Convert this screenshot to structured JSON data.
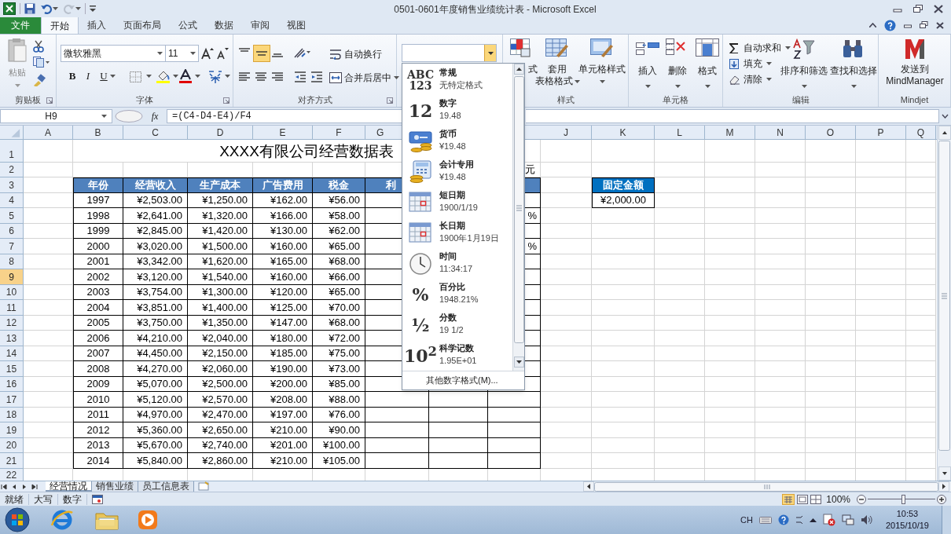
{
  "window": {
    "title": "0501-0601年度销售业绩统计表 - Microsoft Excel"
  },
  "tabs": [
    {
      "label": "文件",
      "kind": "file",
      "selected": false
    },
    {
      "label": "开始",
      "kind": "tab",
      "selected": true
    },
    {
      "label": "插入",
      "kind": "tab",
      "selected": false
    },
    {
      "label": "页面布局",
      "kind": "tab",
      "selected": false
    },
    {
      "label": "公式",
      "kind": "tab",
      "selected": false
    },
    {
      "label": "数据",
      "kind": "tab",
      "selected": false
    },
    {
      "label": "审阅",
      "kind": "tab",
      "selected": false
    },
    {
      "label": "视图",
      "kind": "tab",
      "selected": false
    }
  ],
  "ribbon": {
    "clipboard": {
      "label": "剪贴板",
      "paste": "粘贴"
    },
    "font": {
      "label": "字体",
      "font_name": "微软雅黑",
      "font_size": "11",
      "format_buttons": [
        "B",
        "I",
        "U"
      ]
    },
    "alignment": {
      "label": "对齐方式",
      "wrap": "自动换行",
      "merge": "合并后居中",
      "middle_align_selected": true
    },
    "styles": {
      "label": "样式",
      "buttons": [
        {
          "lines": [
            "式"
          ]
        },
        {
          "lines": [
            "套用",
            "表格格式"
          ]
        },
        {
          "lines": [
            "单元格样式"
          ]
        }
      ]
    },
    "cells": {
      "label": "单元格",
      "buttons": [
        "插入",
        "删除",
        "格式"
      ]
    },
    "editing": {
      "label": "编辑",
      "small": [
        "自动求和",
        "填充",
        "清除"
      ],
      "buttons": [
        "排序和筛选",
        "查找和选择"
      ]
    },
    "mindjet": {
      "label": "Mindjet",
      "button": [
        "发送到",
        "MindManager"
      ]
    }
  },
  "number_format_menu": {
    "items": [
      {
        "kind": "glyph",
        "glyph": [
          "ABC",
          "123"
        ],
        "name": "常规",
        "example": "无特定格式"
      },
      {
        "kind": "glyph",
        "glyph": [
          "12"
        ],
        "name": "数字",
        "example": "19.48"
      },
      {
        "kind": "currency",
        "name": "货币",
        "example": "¥19.48"
      },
      {
        "kind": "accounting",
        "name": "会计专用",
        "example": "¥19.48"
      },
      {
        "kind": "calendar",
        "name": "短日期",
        "example": "1900/1/19"
      },
      {
        "kind": "calendar",
        "name": "长日期",
        "example": "1900年1月19日"
      },
      {
        "kind": "clock",
        "name": "时间",
        "example": "11:34:17"
      },
      {
        "kind": "glyph",
        "glyph": [
          "%"
        ],
        "name": "百分比",
        "example": "1948.21%"
      },
      {
        "kind": "glyph",
        "glyph": [
          "½"
        ],
        "name": "分数",
        "example": "19 1/2"
      },
      {
        "kind": "glyph",
        "glyph": [
          "10$^{2}$"
        ],
        "name": "科学记数",
        "example": "1.95E+01"
      }
    ],
    "more": "其他数字格式(M)..."
  },
  "formula_bar": {
    "name_box": "H9",
    "fx": "fx",
    "formula": "=(C4-D4-E4)/F4"
  },
  "sheet": {
    "columns": [
      "A",
      "B",
      "C",
      "D",
      "E",
      "F",
      "G",
      "J",
      "K",
      "L",
      "M",
      "N",
      "O",
      "P",
      "Q"
    ],
    "rows": [
      {
        "label": "1",
        "selected": false
      },
      {
        "label": "2",
        "selected": false
      },
      {
        "label": "3",
        "selected": false
      },
      {
        "label": "4",
        "selected": false
      },
      {
        "label": "5",
        "selected": false
      },
      {
        "label": "6",
        "selected": false
      },
      {
        "label": "7",
        "selected": false
      },
      {
        "label": "8",
        "selected": false
      },
      {
        "label": "9",
        "selected": true
      },
      {
        "label": "10",
        "selected": false
      },
      {
        "label": "11",
        "selected": false
      },
      {
        "label": "12",
        "selected": false
      },
      {
        "label": "13",
        "selected": false
      },
      {
        "label": "14",
        "selected": false
      },
      {
        "label": "15",
        "selected": false
      },
      {
        "label": "16",
        "selected": false
      },
      {
        "label": "17",
        "selected": false
      },
      {
        "label": "18",
        "selected": false
      },
      {
        "label": "19",
        "selected": false
      },
      {
        "label": "20",
        "selected": false
      },
      {
        "label": "21",
        "selected": false
      },
      {
        "label": "22",
        "selected": false
      }
    ],
    "title": "XXXX有限公司经营数据表",
    "unit": "元",
    "header": [
      "年份",
      "经营收入",
      "生产成本",
      "广告费用",
      "税金",
      "利"
    ],
    "data": [
      [
        "1997",
        "¥2,503.00",
        "¥1,250.00",
        "¥162.00",
        "¥56.00"
      ],
      {
        "cells": [
          "1998",
          "¥2,641.00",
          "¥1,320.00",
          "¥166.00",
          "¥58.00"
        ],
        "rate": "%"
      },
      [
        "1999",
        "¥2,845.00",
        "¥1,420.00",
        "¥130.00",
        "¥62.00"
      ],
      {
        "cells": [
          "2000",
          "¥3,020.00",
          "¥1,500.00",
          "¥160.00",
          "¥65.00"
        ],
        "rate": "%"
      },
      [
        "2001",
        "¥3,342.00",
        "¥1,620.00",
        "¥165.00",
        "¥68.00"
      ],
      [
        "2002",
        "¥3,120.00",
        "¥1,540.00",
        "¥160.00",
        "¥66.00"
      ],
      [
        "2003",
        "¥3,754.00",
        "¥1,300.00",
        "¥120.00",
        "¥65.00"
      ],
      [
        "2004",
        "¥3,851.00",
        "¥1,400.00",
        "¥125.00",
        "¥70.00"
      ],
      [
        "2005",
        "¥3,750.00",
        "¥1,350.00",
        "¥147.00",
        "¥68.00"
      ],
      [
        "2006",
        "¥4,210.00",
        "¥2,040.00",
        "¥180.00",
        "¥72.00"
      ],
      [
        "2007",
        "¥4,450.00",
        "¥2,150.00",
        "¥185.00",
        "¥75.00"
      ],
      [
        "2008",
        "¥4,270.00",
        "¥2,060.00",
        "¥190.00",
        "¥73.00"
      ],
      [
        "2009",
        "¥5,070.00",
        "¥2,500.00",
        "¥200.00",
        "¥85.00"
      ],
      [
        "2010",
        "¥5,120.00",
        "¥2,570.00",
        "¥208.00",
        "¥88.00"
      ],
      [
        "2011",
        "¥4,970.00",
        "¥2,470.00",
        "¥197.00",
        "¥76.00"
      ],
      [
        "2012",
        "¥5,360.00",
        "¥2,650.00",
        "¥210.00",
        "¥90.00"
      ],
      [
        "2013",
        "¥5,670.00",
        "¥2,740.00",
        "¥201.00",
        "¥100.00"
      ],
      [
        "2014",
        "¥5,840.00",
        "¥2,860.00",
        "¥210.00",
        "¥105.00"
      ]
    ],
    "fixed": {
      "header": "固定金额",
      "value": "¥2,000.00"
    }
  },
  "sheet_tabs": [
    {
      "label": "经营情况",
      "selected": true
    },
    {
      "label": "销售业绩",
      "selected": false
    },
    {
      "label": "员工信息表",
      "selected": false
    }
  ],
  "status_bar": {
    "items": [
      "就绪",
      "大写",
      "数字"
    ],
    "zoom": {
      "reading": "100%",
      "level": 0.52
    }
  },
  "taskbar": {
    "language": "CH",
    "time": "10:53",
    "date": "2015/10/19"
  }
}
